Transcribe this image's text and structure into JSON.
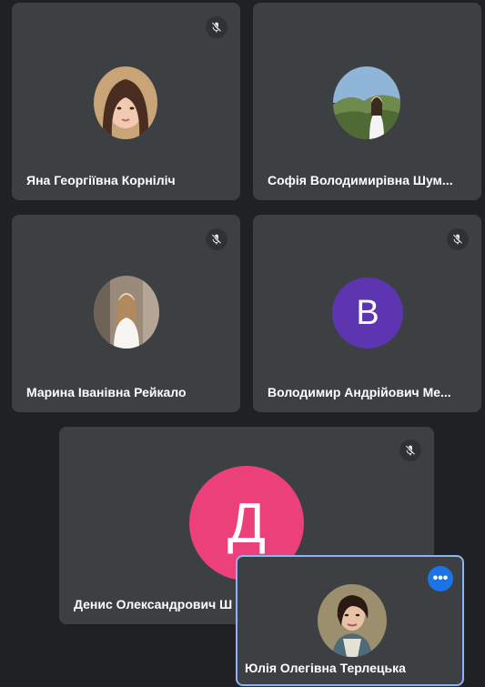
{
  "tiles": [
    {
      "name": "Яна Георгіївна Корніліч",
      "muted": true,
      "avatar": "photo-girl-brown-hair"
    },
    {
      "name": "Софія Володимирівна Шум...",
      "muted": false,
      "avatar": "photo-mountain-landscape"
    },
    {
      "name": "Марина Іванівна Рейкало",
      "muted": true,
      "avatar": "photo-girl-city"
    },
    {
      "name": "Володимир Андрійович Ме...",
      "muted": true,
      "avatar_letter": "В",
      "avatar_color": "#5e35b1"
    },
    {
      "name": "Денис Олександрович Ш",
      "muted": true,
      "avatar_letter": "Д",
      "avatar_color": "#ec407a"
    }
  ],
  "self_view": {
    "name": "Юлія Олегівна Терлецька",
    "avatar": "photo-woman-dark-hair",
    "more_icon": "more-horiz-icon",
    "border_color": "#8ab4f8",
    "more_color": "#1a73e8"
  },
  "icons": {
    "muted": "mic-off-icon"
  }
}
